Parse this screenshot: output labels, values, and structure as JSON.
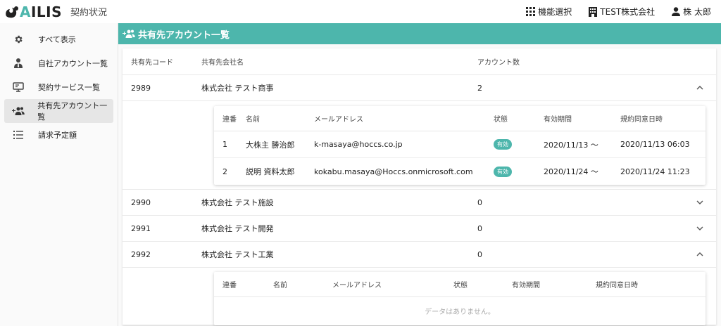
{
  "app": {
    "logo": "AILIS",
    "title": "契約状況"
  },
  "topbar": {
    "function_select": "機能選択",
    "company": "TEST株式会社",
    "user": "株 太郎"
  },
  "sidebar": {
    "items": [
      {
        "label": "すべて表示",
        "icon": "gear-icon"
      },
      {
        "label": "自社アカウント一覧",
        "icon": "person-tie-icon"
      },
      {
        "label": "契約サービス一覧",
        "icon": "monitor-icon"
      },
      {
        "label": "共有先アカウント一覧",
        "icon": "group-add-icon"
      },
      {
        "label": "請求予定額",
        "icon": "list-icon"
      }
    ]
  },
  "main": {
    "title": "共有先アカウント一覧",
    "columns": [
      "共有先コード",
      "共有先会社名",
      "アカウント数"
    ],
    "rows": [
      {
        "code": "2989",
        "name": "株式会社 テスト商事",
        "count": "2"
      },
      {
        "code": "2990",
        "name": "株式会社 テスト施設",
        "count": "0"
      },
      {
        "code": "2991",
        "name": "株式会社 テスト開発",
        "count": "0"
      },
      {
        "code": "2992",
        "name": "株式会社 テスト工業",
        "count": "0"
      }
    ],
    "detail_columns": [
      "連番",
      "名前",
      "メールアドレス",
      "状態",
      "有効期間",
      "規約同意日時"
    ],
    "detail_rows": [
      {
        "no": "1",
        "name": "大株主 勝治郎",
        "email": "k-masaya@hoccs.co.jp",
        "status": "有効",
        "period": "2020/11/13 ～",
        "agreed": "2020/11/13 06:03"
      },
      {
        "no": "2",
        "name": "説明 資料太郎",
        "email": "kokabu.masaya@Hoccs.onmicrosoft.com",
        "status": "有効",
        "period": "2020/11/24 ～",
        "agreed": "2020/11/24 11:23"
      }
    ],
    "no_data": "データはありません。"
  },
  "colors": {
    "accent": "#4db6ac"
  }
}
